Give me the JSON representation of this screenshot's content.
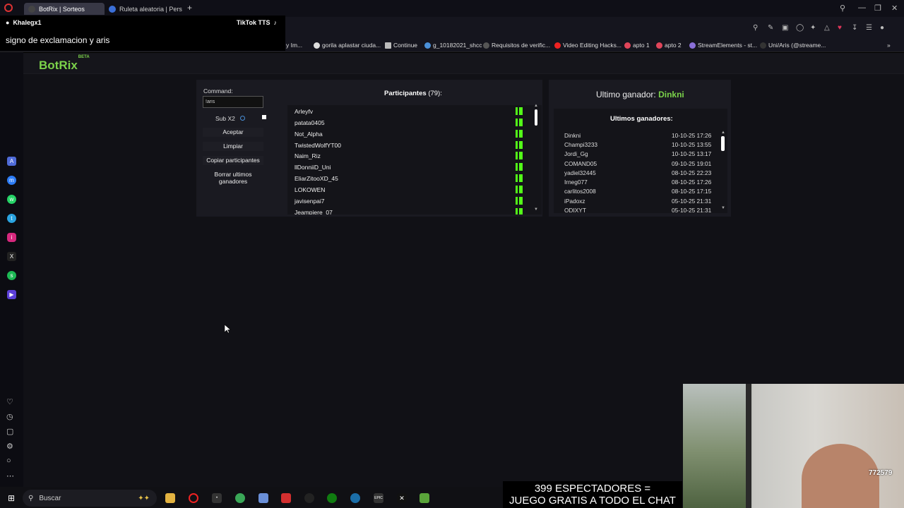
{
  "browser": {
    "tabs": [
      {
        "label": "BotRix | Sorteos",
        "active": true
      },
      {
        "label": "Ruleta aleatoria | Personal",
        "active": false
      }
    ],
    "new_tab": "+",
    "bookmarks": [
      "y Im...",
      "gorila aplastar ciuda...",
      "Continue",
      "g_10182021_shcc",
      "Requisitos de verific...",
      "Video Editing Hacks...",
      "apto 1",
      "apto 2",
      "StreamElements - st...",
      "Uni/Aris (@streame..."
    ]
  },
  "tiktok_tts": {
    "user": "Khalegx1",
    "brand": "TikTok TTS",
    "message": "signo de exclamacion y aris"
  },
  "app": {
    "logo": "BotRix",
    "logo_badge": "BETA",
    "command_label": "Command:",
    "command_value": "!aris",
    "sub_label": "Sub X2",
    "buttons": {
      "accept": "Aceptar",
      "clear": "Limpiar",
      "copy": "Copiar participantes",
      "delete_winners": "Borrar ultimos ganadores"
    },
    "participants_title": "Participantes",
    "participants_count": "(79):",
    "participants": [
      "Arleyfv",
      "patata0405",
      "Not_Alpha",
      "TwistedWolfYT00",
      "Naim_Riz",
      "llDonniiD_Uni",
      "EliarZitooXD_45",
      "LOKOWEN",
      "javisenpai7",
      "Jeampiere_07"
    ],
    "last_winner_label": "Ultimo ganador:",
    "last_winner": "Dinkni",
    "winners_title": "Ultimos ganadores:",
    "winners": [
      {
        "name": "Dinkni",
        "date": "10-10-25 17:26"
      },
      {
        "name": "Champi3233",
        "date": "10-10-25 13:55"
      },
      {
        "name": "Jordi_Gg",
        "date": "10-10-25 13:17"
      },
      {
        "name": "COMAND05",
        "date": "09-10-25 19:01"
      },
      {
        "name": "yadiel32445",
        "date": "08-10-25 22:23"
      },
      {
        "name": "Irneg077",
        "date": "08-10-25 17:26"
      },
      {
        "name": "carlitos2008",
        "date": "08-10-25 17:15"
      },
      {
        "name": "iPadoxz",
        "date": "05-10-25 21:31"
      },
      {
        "name": "ODIXYT",
        "date": "05-10-25 21:31"
      }
    ]
  },
  "taskbar": {
    "search": "Buscar"
  },
  "stream": {
    "viewers_line1": "399 ESPECTADORES =",
    "viewers_line2": "JUEGO GRATIS A TODO EL CHAT",
    "badge": "772579"
  },
  "colors": {
    "accent_green": "#7bd24a",
    "kick_green": "#53fc18"
  }
}
